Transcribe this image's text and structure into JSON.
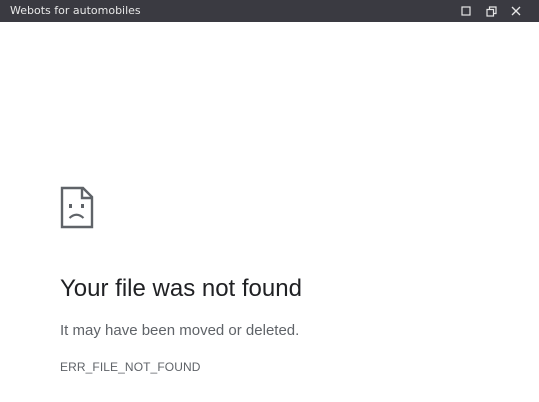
{
  "window": {
    "title": "Webots for automobiles",
    "buttons": {
      "maximize_icon": "maximize-icon",
      "restore_icon": "restore-icon",
      "close_icon": "close-icon"
    },
    "titlebar_color": "#3a3a41"
  },
  "error_page": {
    "icon": "sad-file-icon",
    "heading": "Your file was not found",
    "message": "It may have been moved or deleted.",
    "error_code": "ERR_FILE_NOT_FOUND",
    "heading_color": "#202124",
    "text_color": "#5f6368"
  }
}
